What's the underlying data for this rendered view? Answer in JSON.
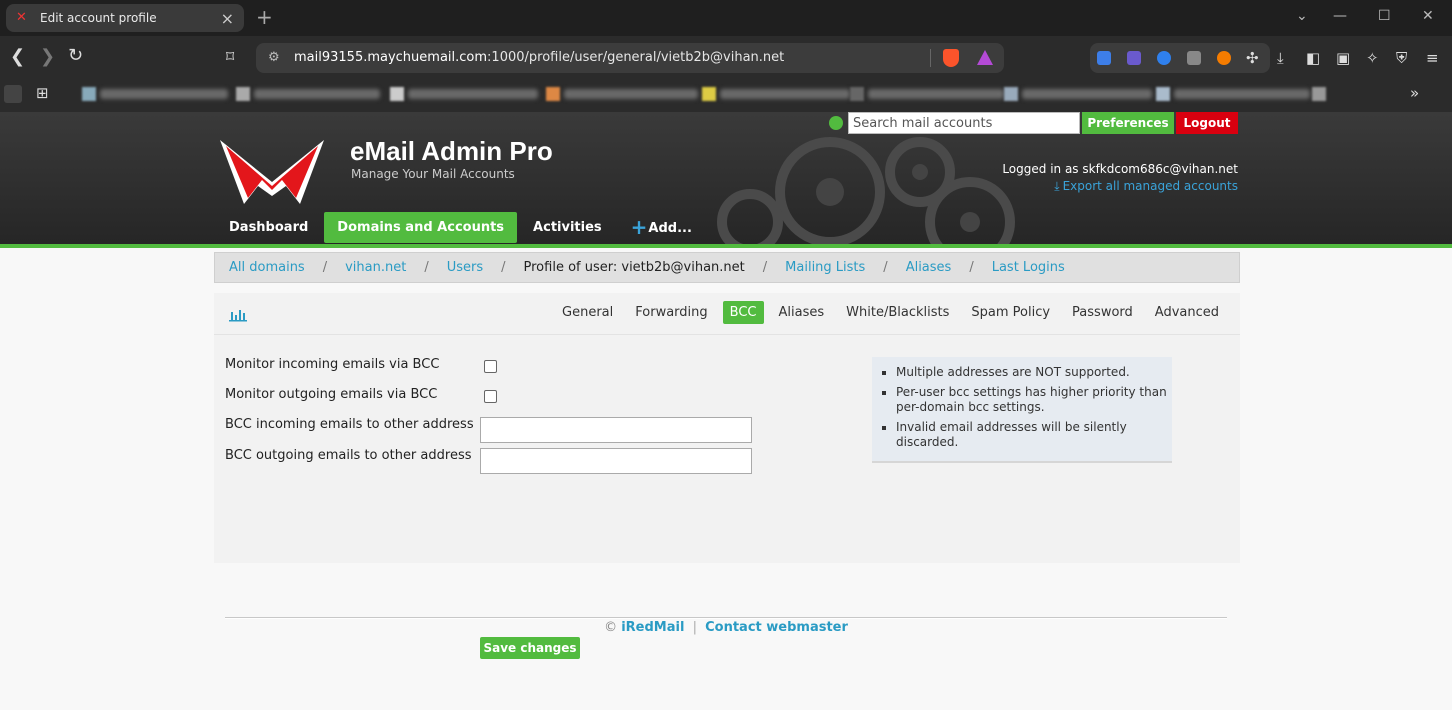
{
  "browser": {
    "tab_title": "Edit account profile",
    "url_host": "mail93155.maychuemail.com",
    "url_rest": ":1000/profile/user/general/vietb2b@vihan.net"
  },
  "app": {
    "title": "eMail Admin Pro",
    "subtitle": "Manage Your Mail Accounts",
    "search_placeholder": "Search mail accounts",
    "preferences_label": "Preferences",
    "logout_label": "Logout",
    "logged_in_text": "Logged in as skfkdcom686c@vihan.net",
    "export_label": "Export all managed accounts"
  },
  "mainnav": {
    "dashboard": "Dashboard",
    "domains": "Domains and Accounts",
    "activities": "Activities",
    "add": "Add..."
  },
  "breadcrumb": {
    "all_domains": "All domains",
    "domain": "vihan.net",
    "users": "Users",
    "profile": "Profile of user: vietb2b@vihan.net",
    "mailing_lists": "Mailing Lists",
    "aliases": "Aliases",
    "last_logins": "Last Logins",
    "sep": "/"
  },
  "tabs": {
    "general": "General",
    "forwarding": "Forwarding",
    "bcc": "BCC",
    "aliases": "Aliases",
    "whiteblack": "White/Blacklists",
    "spam": "Spam Policy",
    "password": "Password",
    "advanced": "Advanced",
    "active": "BCC"
  },
  "form": {
    "monitor_in_label": "Monitor incoming emails via BCC",
    "monitor_in_checked": false,
    "monitor_out_label": "Monitor outgoing emails via BCC",
    "monitor_out_checked": false,
    "bcc_in_label": "BCC incoming emails to other address",
    "bcc_in_value": "",
    "bcc_out_label": "BCC outgoing emails to other address",
    "bcc_out_value": "",
    "save_label": "Save changes"
  },
  "notes": {
    "items": [
      "Multiple addresses are NOT supported.",
      "Per-user bcc settings has higher priority than per-domain bcc settings.",
      "Invalid email addresses will be silently discarded."
    ]
  },
  "footer": {
    "copyright": "©",
    "iredmail": "iRedMail",
    "separator": "|",
    "contact": "Contact webmaster"
  },
  "colors": {
    "accent_green": "#52bb3f",
    "logout_red": "#d9000f",
    "link_blue": "#2a9bc4"
  }
}
